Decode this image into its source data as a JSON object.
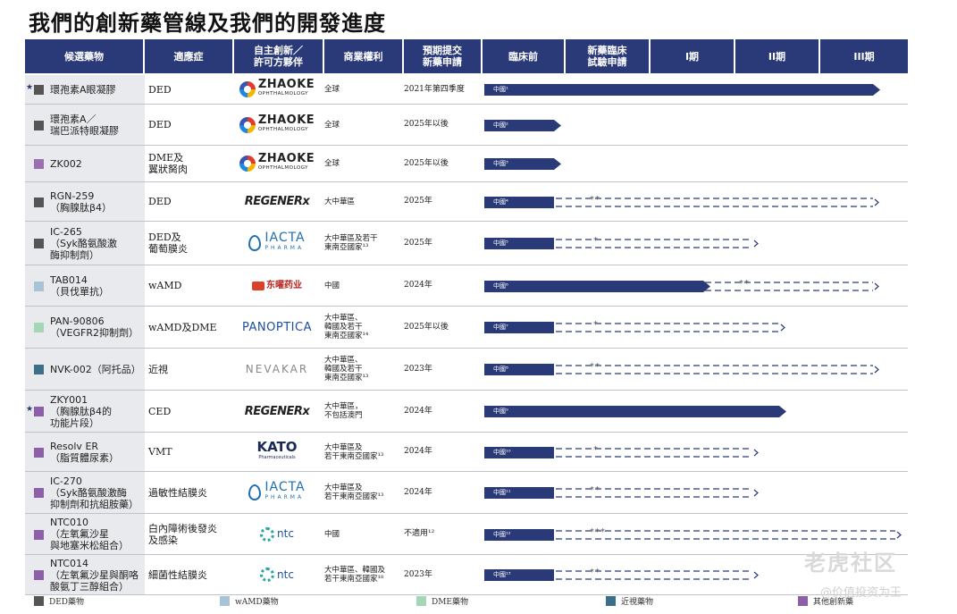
{
  "title": "我們的創新藥管線及我們的開發進度",
  "columns": [
    "候選藥物",
    "適應症",
    "自主創新／\n許可方夥伴",
    "商業權利",
    "預期提交\n新藥申請",
    "臨床前",
    "新藥臨床\n試驗申請",
    "I期",
    "II期",
    "III期"
  ],
  "colors": {
    "header": "#2a3a78",
    "bar": "#2a3a78",
    "ded": "#555555",
    "wamd": "#a9c3d6",
    "dme": "#a5d6b5",
    "myopia": "#3c6f88",
    "other": "#8e5ea8"
  },
  "rows": [
    {
      "star": "★",
      "color": "#555555",
      "drug": "環孢素A眼凝膠",
      "indication": "DED",
      "partner": "zhaoke",
      "partner_text": "ZHAOKE",
      "partner_sub": "OPHTHALMOLOGY",
      "rights": "全球",
      "nda": "2021年第四季度",
      "bar_label": "中國¹",
      "solid_end": 435,
      "arrow": true,
      "dash_end": null,
      "stars": ""
    },
    {
      "star": "",
      "color": "#555555",
      "drug": "環孢素A／\n瑞巴派特眼凝膠",
      "indication": "DED",
      "partner": "zhaoke",
      "partner_text": "ZHAOKE",
      "partner_sub": "OPHTHALMOLOGY",
      "rights": "全球",
      "nda": "2025年以後",
      "bar_label": "中國²",
      "solid_end": 78,
      "arrow": true,
      "dash_end": null,
      "stars": ""
    },
    {
      "star": "",
      "color": "#9b6fb0",
      "drug": "ZK002",
      "indication": "DME及\n翼狀胬肉",
      "partner": "zhaoke",
      "partner_text": "ZHAOKE",
      "partner_sub": "OPHTHALMOLOGY",
      "rights": "全球",
      "nda": "2025年以後",
      "bar_label": "中國³",
      "solid_end": 78,
      "arrow": true,
      "dash_end": null,
      "stars": ""
    },
    {
      "star": "",
      "color": "#555555",
      "drug": "RGN-259\n（胸腺肽β4）",
      "indication": "DED",
      "partner": "regenerx",
      "partner_text": "REGENERx",
      "partner_sub": "",
      "rights": "大中華區",
      "nda": "2025年",
      "bar_label": "中國⁴",
      "solid_end": 78,
      "arrow": false,
      "dash_end": 435,
      "stars": "**"
    },
    {
      "star": "",
      "color": "#555555",
      "drug": "IC-265\n（Syk酪氨酸激\n酶抑制劑）",
      "indication": "DED及\n葡萄膜炎",
      "partner": "iacta",
      "partner_text": "IACTA",
      "partner_sub": "PHARMA",
      "rights": "大中華區及若干\n東南亞國家¹³",
      "nda": "2025年",
      "bar_label": "中國⁵",
      "solid_end": 78,
      "arrow": false,
      "dash_end": 300,
      "stars": "*"
    },
    {
      "star": "",
      "color": "#a9c3d6",
      "drug": "TAB014\n（貝伐單抗）",
      "indication": "wAMD",
      "partner": "dongyao",
      "partner_text": "东曜药业",
      "partner_sub": "",
      "rights": "中國",
      "nda": "2024年",
      "bar_label": "中國⁶",
      "solid_end": 245,
      "arrow": true,
      "dash_end": 435,
      "stars": "**"
    },
    {
      "star": "",
      "color": "#a5d6b5",
      "drug": "PAN-90806\n（VEGFR2抑制劑）",
      "indication": "wAMD及DME",
      "partner": "panoptica",
      "partner_text": "PANOPTICA",
      "partner_sub": "",
      "rights": "大中華區、\n韓國及若干\n東南亞國家¹⁴",
      "nda": "2025年以後",
      "bar_label": "中國⁷",
      "solid_end": 78,
      "arrow": false,
      "dash_end": 330,
      "stars": "*"
    },
    {
      "star": "",
      "color": "#3c6f88",
      "drug": "NVK-002（阿托品）",
      "indication": "近視",
      "partner": "nevakar",
      "partner_text": "NEVAKAR",
      "partner_sub": "",
      "rights": "大中華區、\n韓國及若干\n東南亞國家¹³",
      "nda": "2023年",
      "bar_label": "中國⁸",
      "solid_end": 78,
      "arrow": false,
      "dash_end": 435,
      "stars": "**"
    },
    {
      "star": "★",
      "color": "#8e5ea8",
      "drug": "ZKY001\n（胸腺肽β4的\n功能片段）",
      "indication": "CED",
      "partner": "regenerx",
      "partner_text": "REGENERx",
      "partner_sub": "",
      "rights": "大中華區，\n不包括澳門",
      "nda": "2024年",
      "bar_label": "中國⁹",
      "solid_end": 330,
      "arrow": true,
      "dash_end": null,
      "stars": ""
    },
    {
      "star": "",
      "color": "#8e5ea8",
      "drug": "Resolv ER\n（脂質體尿素）",
      "indication": "VMT",
      "partner": "kato",
      "partner_text": "KATO",
      "partner_sub": "Pharmaceuticals",
      "rights": "大中華區及\n若干東南亞國家¹³",
      "nda": "2024年",
      "bar_label": "中國¹⁰",
      "solid_end": 78,
      "arrow": false,
      "dash_end": 300,
      "stars": "*"
    },
    {
      "star": "",
      "color": "#8e5ea8",
      "drug": "IC-270\n（Syk酪氨酸激酶\n抑制劑和抗組胺藥）",
      "indication": "過敏性結膜炎",
      "partner": "iacta",
      "partner_text": "IACTA",
      "partner_sub": "PHARMA",
      "rights": "大中華區及\n若干東南亞國家¹³",
      "nda": "2024年",
      "bar_label": "中國¹¹",
      "solid_end": 78,
      "arrow": false,
      "dash_end": 300,
      "stars": "**"
    },
    {
      "star": "",
      "color": "#8e5ea8",
      "drug": "NTC010\n（左氧氟沙星\n與地塞米松組合）",
      "indication": "白內障術後發炎\n及感染",
      "partner": "ntc",
      "partner_text": "ntc",
      "partner_sub": "",
      "rights": "中國",
      "nda": "不適用¹²",
      "bar_label": "中國¹²",
      "solid_end": 78,
      "arrow": false,
      "dash_end": 460,
      "stars": "***"
    },
    {
      "star": "",
      "color": "#8e5ea8",
      "drug": "NTC014\n（左氧氟沙星與酮咯\n酸氨丁三醇組合）",
      "indication": "細菌性結膜炎",
      "partner": "ntc",
      "partner_text": "ntc",
      "partner_sub": "",
      "rights": "大中華區、韓國及\n若干東南亞國家¹⁸",
      "nda": "2023年",
      "bar_label": "中國¹³",
      "solid_end": 78,
      "arrow": false,
      "dash_end": 300,
      "stars": "**"
    }
  ],
  "legend": [
    {
      "label": "DED藥物",
      "color": "#555555"
    },
    {
      "label": "wAMD藥物",
      "color": "#a9c3d6"
    },
    {
      "label": "DME藥物",
      "color": "#a5d6b5"
    },
    {
      "label": "近視藥物",
      "color": "#3c6f88"
    },
    {
      "label": "其他創新藥",
      "color": "#8e5ea8"
    }
  ],
  "watermark": "老虎社区",
  "watermark_sub": "@价值投资为王"
}
